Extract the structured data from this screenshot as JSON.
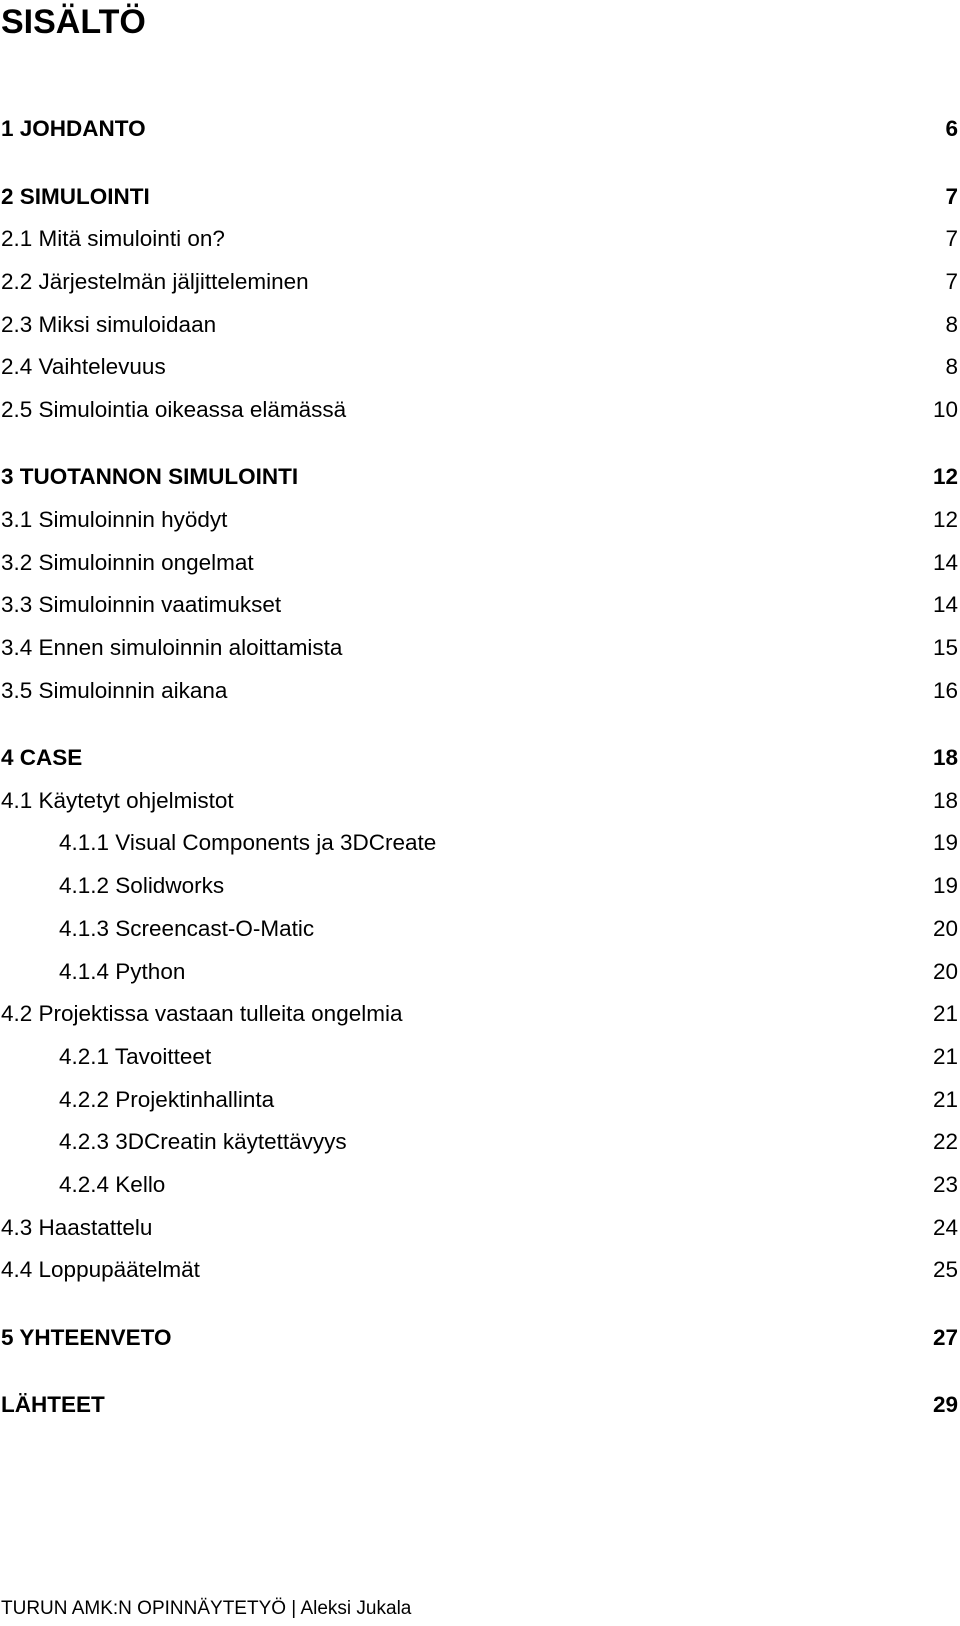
{
  "title": "SISÄLTÖ",
  "entries": [
    {
      "text": "1 JOHDANTO",
      "page": "6",
      "level": 1
    },
    {
      "text": "2 SIMULOINTI",
      "page": "7",
      "level": 1
    },
    {
      "text": "2.1 Mitä simulointi on?",
      "page": "7",
      "level": 2
    },
    {
      "text": "2.2 Järjestelmän jäljitteleminen",
      "page": "7",
      "level": 2
    },
    {
      "text": "2.3 Miksi simuloidaan",
      "page": "8",
      "level": 2
    },
    {
      "text": "2.4 Vaihtelevuus",
      "page": "8",
      "level": 2
    },
    {
      "text": "2.5 Simulointia oikeassa elämässä",
      "page": "10",
      "level": 2
    },
    {
      "text": "3 TUOTANNON SIMULOINTI",
      "page": "12",
      "level": 1
    },
    {
      "text": "3.1 Simuloinnin hyödyt",
      "page": "12",
      "level": 2
    },
    {
      "text": "3.2 Simuloinnin ongelmat",
      "page": "14",
      "level": 2
    },
    {
      "text": "3.3 Simuloinnin vaatimukset",
      "page": "14",
      "level": 2
    },
    {
      "text": "3.4 Ennen simuloinnin aloittamista",
      "page": "15",
      "level": 2
    },
    {
      "text": "3.5 Simuloinnin aikana",
      "page": "16",
      "level": 2
    },
    {
      "text": "4 CASE",
      "page": "18",
      "level": 1
    },
    {
      "text": "4.1 Käytetyt ohjelmistot",
      "page": "18",
      "level": 2
    },
    {
      "text": "4.1.1 Visual Components ja 3DCreate",
      "page": "19",
      "level": 3
    },
    {
      "text": "4.1.2 Solidworks",
      "page": "19",
      "level": 3
    },
    {
      "text": "4.1.3 Screencast-O-Matic",
      "page": "20",
      "level": 3
    },
    {
      "text": "4.1.4 Python",
      "page": "20",
      "level": 3
    },
    {
      "text": "4.2 Projektissa vastaan tulleita ongelmia",
      "page": "21",
      "level": 2
    },
    {
      "text": "4.2.1 Tavoitteet",
      "page": "21",
      "level": 3
    },
    {
      "text": "4.2.2 Projektinhallinta",
      "page": "21",
      "level": 3
    },
    {
      "text": "4.2.3 3DCreatin käytettävyys",
      "page": "22",
      "level": 3
    },
    {
      "text": "4.2.4 Kello",
      "page": "23",
      "level": 3
    },
    {
      "text": "4.3 Haastattelu",
      "page": "24",
      "level": 2
    },
    {
      "text": "4.4 Loppupäätelmät",
      "page": "25",
      "level": 2
    },
    {
      "text": "5 YHTEENVETO",
      "page": "27",
      "level": 1
    },
    {
      "text": "LÄHTEET",
      "page": "29",
      "level": 1
    }
  ],
  "footer": "TURUN AMK:N OPINNÄYTETYÖ | Aleksi Jukala"
}
